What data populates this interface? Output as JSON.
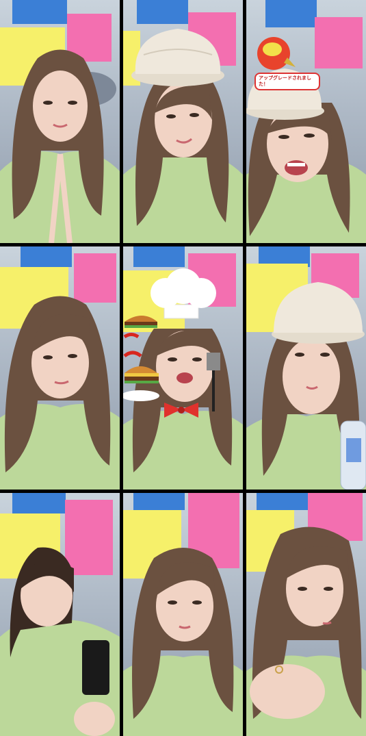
{
  "tiles": [
    {
      "id": 1,
      "overlay": "none"
    },
    {
      "id": 2,
      "overlay": "cap"
    },
    {
      "id": 3,
      "overlay": "cap-upgrade"
    },
    {
      "id": 4,
      "overlay": "none"
    },
    {
      "id": 5,
      "overlay": "chef"
    },
    {
      "id": 6,
      "overlay": "cap-bottle"
    },
    {
      "id": 7,
      "overlay": "none"
    },
    {
      "id": 8,
      "overlay": "none"
    },
    {
      "id": 9,
      "overlay": "none"
    }
  ],
  "upgrade_badge": {
    "text": "アップグレードされました！"
  },
  "colors": {
    "background": "#000000",
    "wall": "#aeb9c6",
    "shirt": "#bcd89a",
    "hair": "#6b5140",
    "skin": "#f1d3c4",
    "sticky_yellow": "#f6f06a",
    "sticky_pink": "#f36fb0",
    "cap": "#efe8dc",
    "bowtie": "#e0322d"
  }
}
